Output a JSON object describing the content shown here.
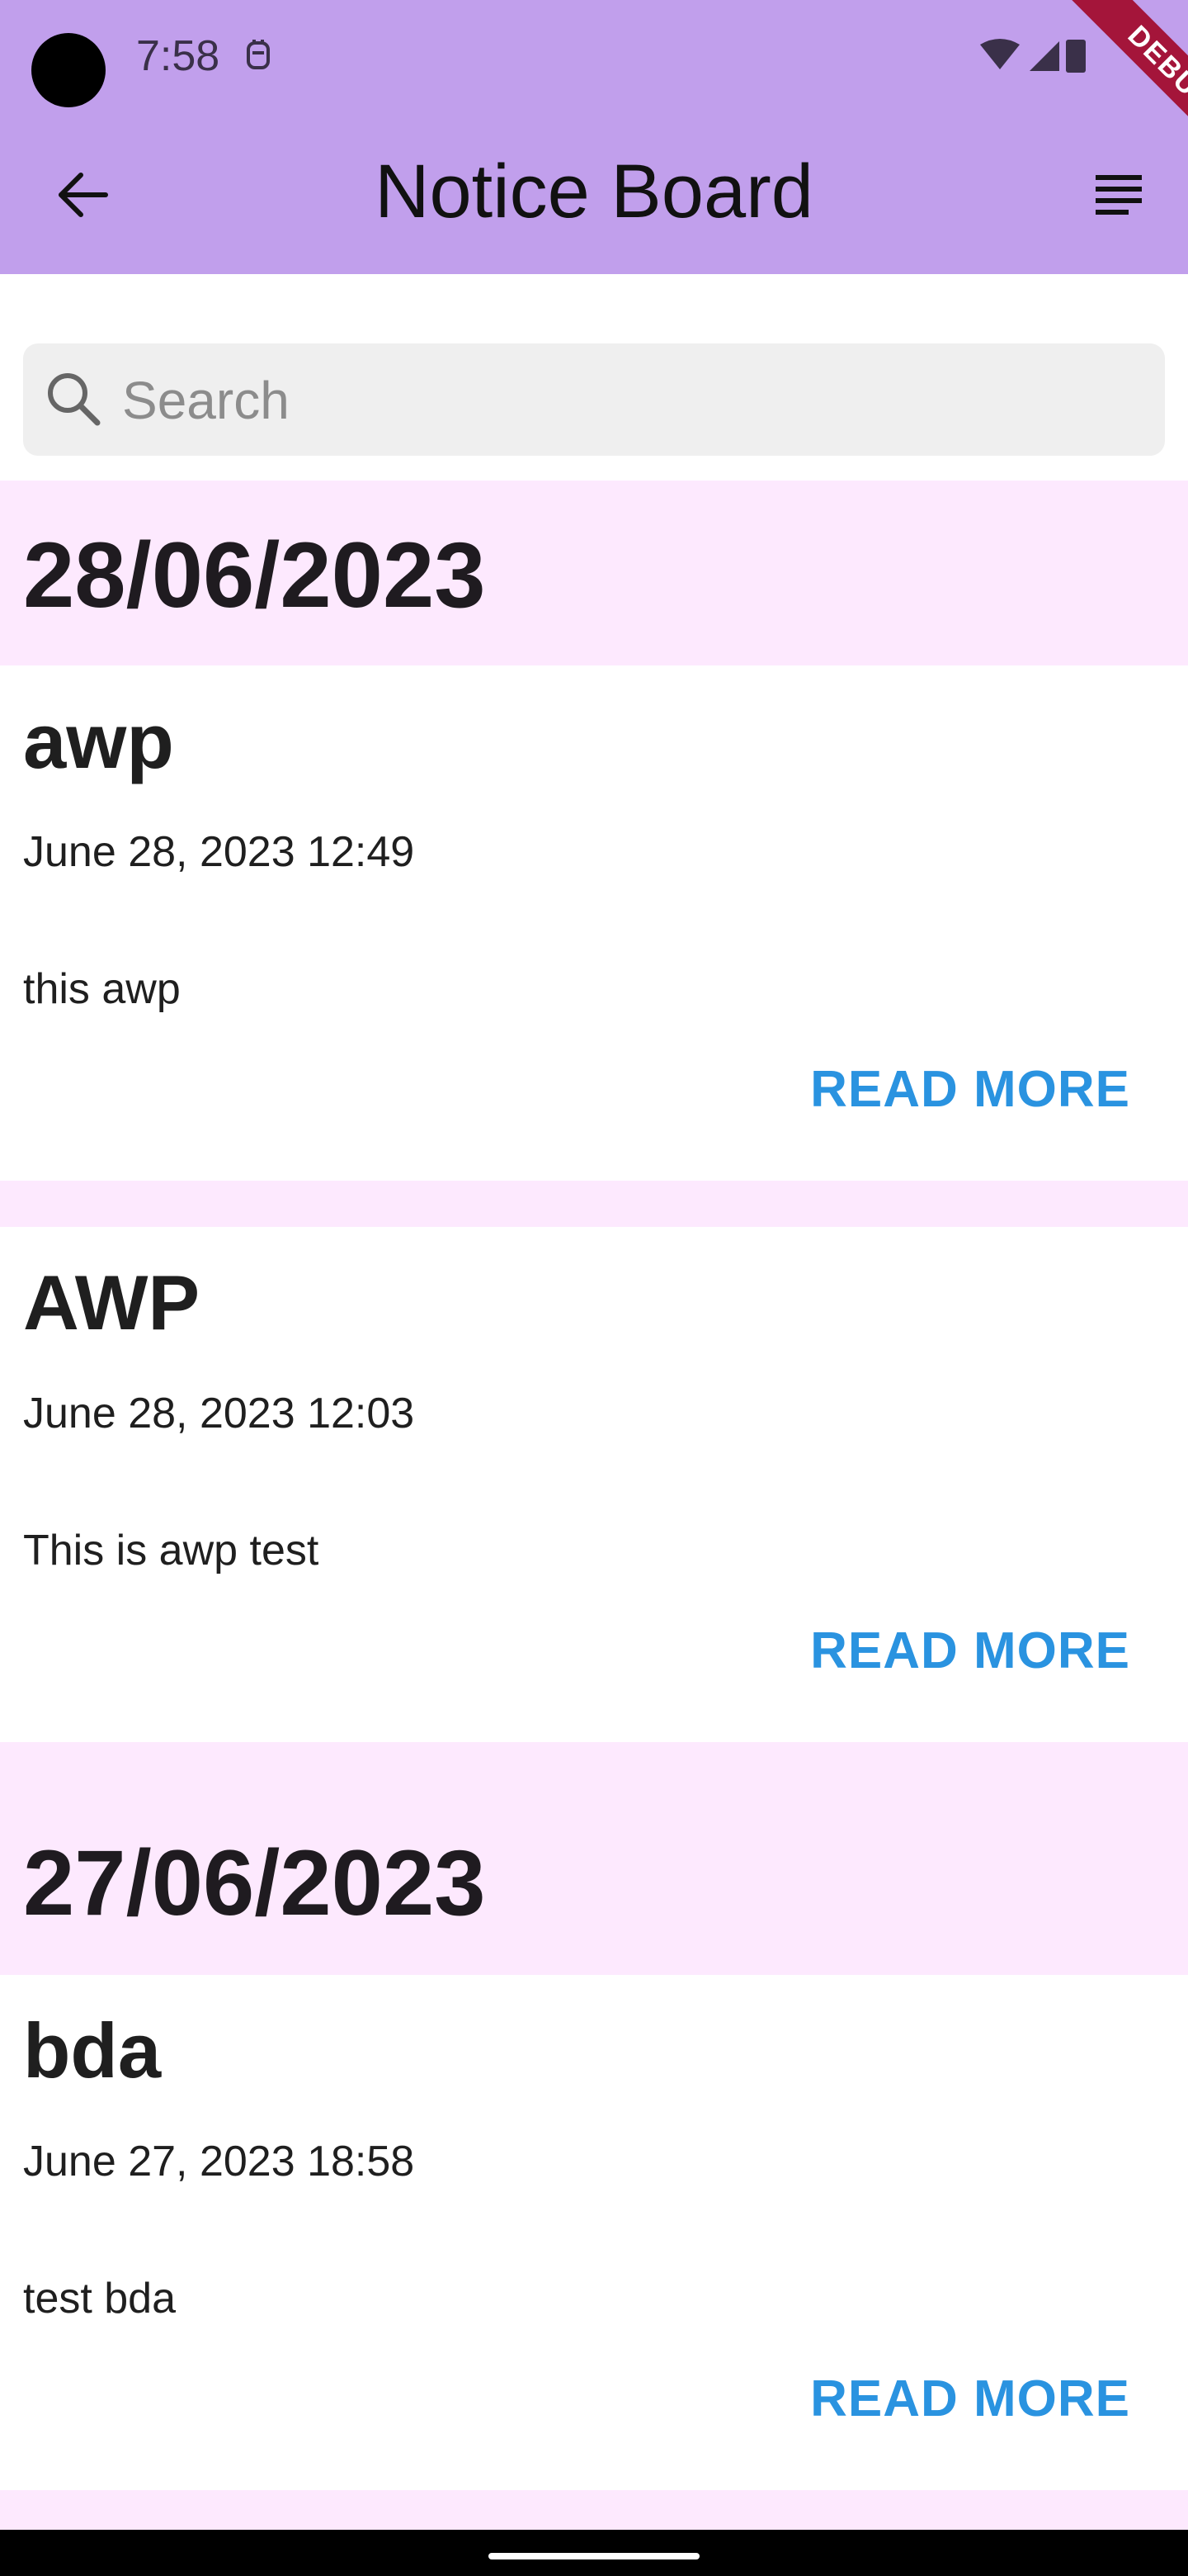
{
  "status_bar": {
    "time": "7:58"
  },
  "debug_banner": "DEBUG",
  "app_bar": {
    "title": "Notice Board"
  },
  "search": {
    "placeholder": "Search",
    "value": ""
  },
  "groups": [
    {
      "date": "28/06/2023",
      "notices": [
        {
          "title": "awp",
          "timestamp": "June 28, 2023 12:49",
          "body": "this awp",
          "action": "READ MORE"
        },
        {
          "title": "AWP",
          "timestamp": "June 28, 2023 12:03",
          "body": "This is awp test",
          "action": "READ MORE"
        }
      ]
    },
    {
      "date": "27/06/2023",
      "notices": [
        {
          "title": "bda",
          "timestamp": "June 27, 2023 18:58",
          "body": "test bda",
          "action": "READ MORE"
        }
      ]
    }
  ],
  "colors": {
    "app_bar": "#c19fec",
    "date_band": "#fde9fe",
    "link": "#2a93e0",
    "debug_ribbon": "#a4153a"
  },
  "icons": {
    "back": "arrow-left-icon",
    "menu": "list-lines-icon",
    "search": "magnifier-icon"
  }
}
